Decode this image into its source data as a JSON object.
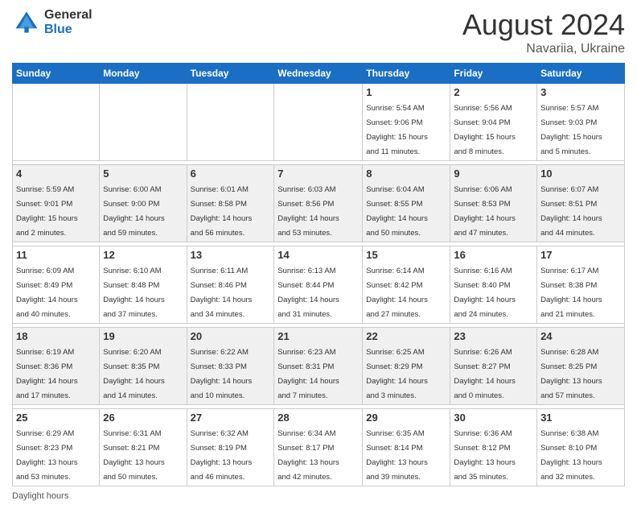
{
  "header": {
    "logo_general": "General",
    "logo_blue": "Blue",
    "title": "August 2024",
    "location": "Navariia, Ukraine"
  },
  "days_of_week": [
    "Sunday",
    "Monday",
    "Tuesday",
    "Wednesday",
    "Thursday",
    "Friday",
    "Saturday"
  ],
  "footer": {
    "note": "Daylight hours"
  },
  "weeks": [
    {
      "days": [
        {
          "num": "",
          "info": ""
        },
        {
          "num": "",
          "info": ""
        },
        {
          "num": "",
          "info": ""
        },
        {
          "num": "",
          "info": ""
        },
        {
          "num": "1",
          "info": "Sunrise: 5:54 AM\nSunset: 9:06 PM\nDaylight: 15 hours\nand 11 minutes."
        },
        {
          "num": "2",
          "info": "Sunrise: 5:56 AM\nSunset: 9:04 PM\nDaylight: 15 hours\nand 8 minutes."
        },
        {
          "num": "3",
          "info": "Sunrise: 5:57 AM\nSunset: 9:03 PM\nDaylight: 15 hours\nand 5 minutes."
        }
      ]
    },
    {
      "days": [
        {
          "num": "4",
          "info": "Sunrise: 5:59 AM\nSunset: 9:01 PM\nDaylight: 15 hours\nand 2 minutes."
        },
        {
          "num": "5",
          "info": "Sunrise: 6:00 AM\nSunset: 9:00 PM\nDaylight: 14 hours\nand 59 minutes."
        },
        {
          "num": "6",
          "info": "Sunrise: 6:01 AM\nSunset: 8:58 PM\nDaylight: 14 hours\nand 56 minutes."
        },
        {
          "num": "7",
          "info": "Sunrise: 6:03 AM\nSunset: 8:56 PM\nDaylight: 14 hours\nand 53 minutes."
        },
        {
          "num": "8",
          "info": "Sunrise: 6:04 AM\nSunset: 8:55 PM\nDaylight: 14 hours\nand 50 minutes."
        },
        {
          "num": "9",
          "info": "Sunrise: 6:06 AM\nSunset: 8:53 PM\nDaylight: 14 hours\nand 47 minutes."
        },
        {
          "num": "10",
          "info": "Sunrise: 6:07 AM\nSunset: 8:51 PM\nDaylight: 14 hours\nand 44 minutes."
        }
      ]
    },
    {
      "days": [
        {
          "num": "11",
          "info": "Sunrise: 6:09 AM\nSunset: 8:49 PM\nDaylight: 14 hours\nand 40 minutes."
        },
        {
          "num": "12",
          "info": "Sunrise: 6:10 AM\nSunset: 8:48 PM\nDaylight: 14 hours\nand 37 minutes."
        },
        {
          "num": "13",
          "info": "Sunrise: 6:11 AM\nSunset: 8:46 PM\nDaylight: 14 hours\nand 34 minutes."
        },
        {
          "num": "14",
          "info": "Sunrise: 6:13 AM\nSunset: 8:44 PM\nDaylight: 14 hours\nand 31 minutes."
        },
        {
          "num": "15",
          "info": "Sunrise: 6:14 AM\nSunset: 8:42 PM\nDaylight: 14 hours\nand 27 minutes."
        },
        {
          "num": "16",
          "info": "Sunrise: 6:16 AM\nSunset: 8:40 PM\nDaylight: 14 hours\nand 24 minutes."
        },
        {
          "num": "17",
          "info": "Sunrise: 6:17 AM\nSunset: 8:38 PM\nDaylight: 14 hours\nand 21 minutes."
        }
      ]
    },
    {
      "days": [
        {
          "num": "18",
          "info": "Sunrise: 6:19 AM\nSunset: 8:36 PM\nDaylight: 14 hours\nand 17 minutes."
        },
        {
          "num": "19",
          "info": "Sunrise: 6:20 AM\nSunset: 8:35 PM\nDaylight: 14 hours\nand 14 minutes."
        },
        {
          "num": "20",
          "info": "Sunrise: 6:22 AM\nSunset: 8:33 PM\nDaylight: 14 hours\nand 10 minutes."
        },
        {
          "num": "21",
          "info": "Sunrise: 6:23 AM\nSunset: 8:31 PM\nDaylight: 14 hours\nand 7 minutes."
        },
        {
          "num": "22",
          "info": "Sunrise: 6:25 AM\nSunset: 8:29 PM\nDaylight: 14 hours\nand 3 minutes."
        },
        {
          "num": "23",
          "info": "Sunrise: 6:26 AM\nSunset: 8:27 PM\nDaylight: 14 hours\nand 0 minutes."
        },
        {
          "num": "24",
          "info": "Sunrise: 6:28 AM\nSunset: 8:25 PM\nDaylight: 13 hours\nand 57 minutes."
        }
      ]
    },
    {
      "days": [
        {
          "num": "25",
          "info": "Sunrise: 6:29 AM\nSunset: 8:23 PM\nDaylight: 13 hours\nand 53 minutes."
        },
        {
          "num": "26",
          "info": "Sunrise: 6:31 AM\nSunset: 8:21 PM\nDaylight: 13 hours\nand 50 minutes."
        },
        {
          "num": "27",
          "info": "Sunrise: 6:32 AM\nSunset: 8:19 PM\nDaylight: 13 hours\nand 46 minutes."
        },
        {
          "num": "28",
          "info": "Sunrise: 6:34 AM\nSunset: 8:17 PM\nDaylight: 13 hours\nand 42 minutes."
        },
        {
          "num": "29",
          "info": "Sunrise: 6:35 AM\nSunset: 8:14 PM\nDaylight: 13 hours\nand 39 minutes."
        },
        {
          "num": "30",
          "info": "Sunrise: 6:36 AM\nSunset: 8:12 PM\nDaylight: 13 hours\nand 35 minutes."
        },
        {
          "num": "31",
          "info": "Sunrise: 6:38 AM\nSunset: 8:10 PM\nDaylight: 13 hours\nand 32 minutes."
        }
      ]
    }
  ]
}
